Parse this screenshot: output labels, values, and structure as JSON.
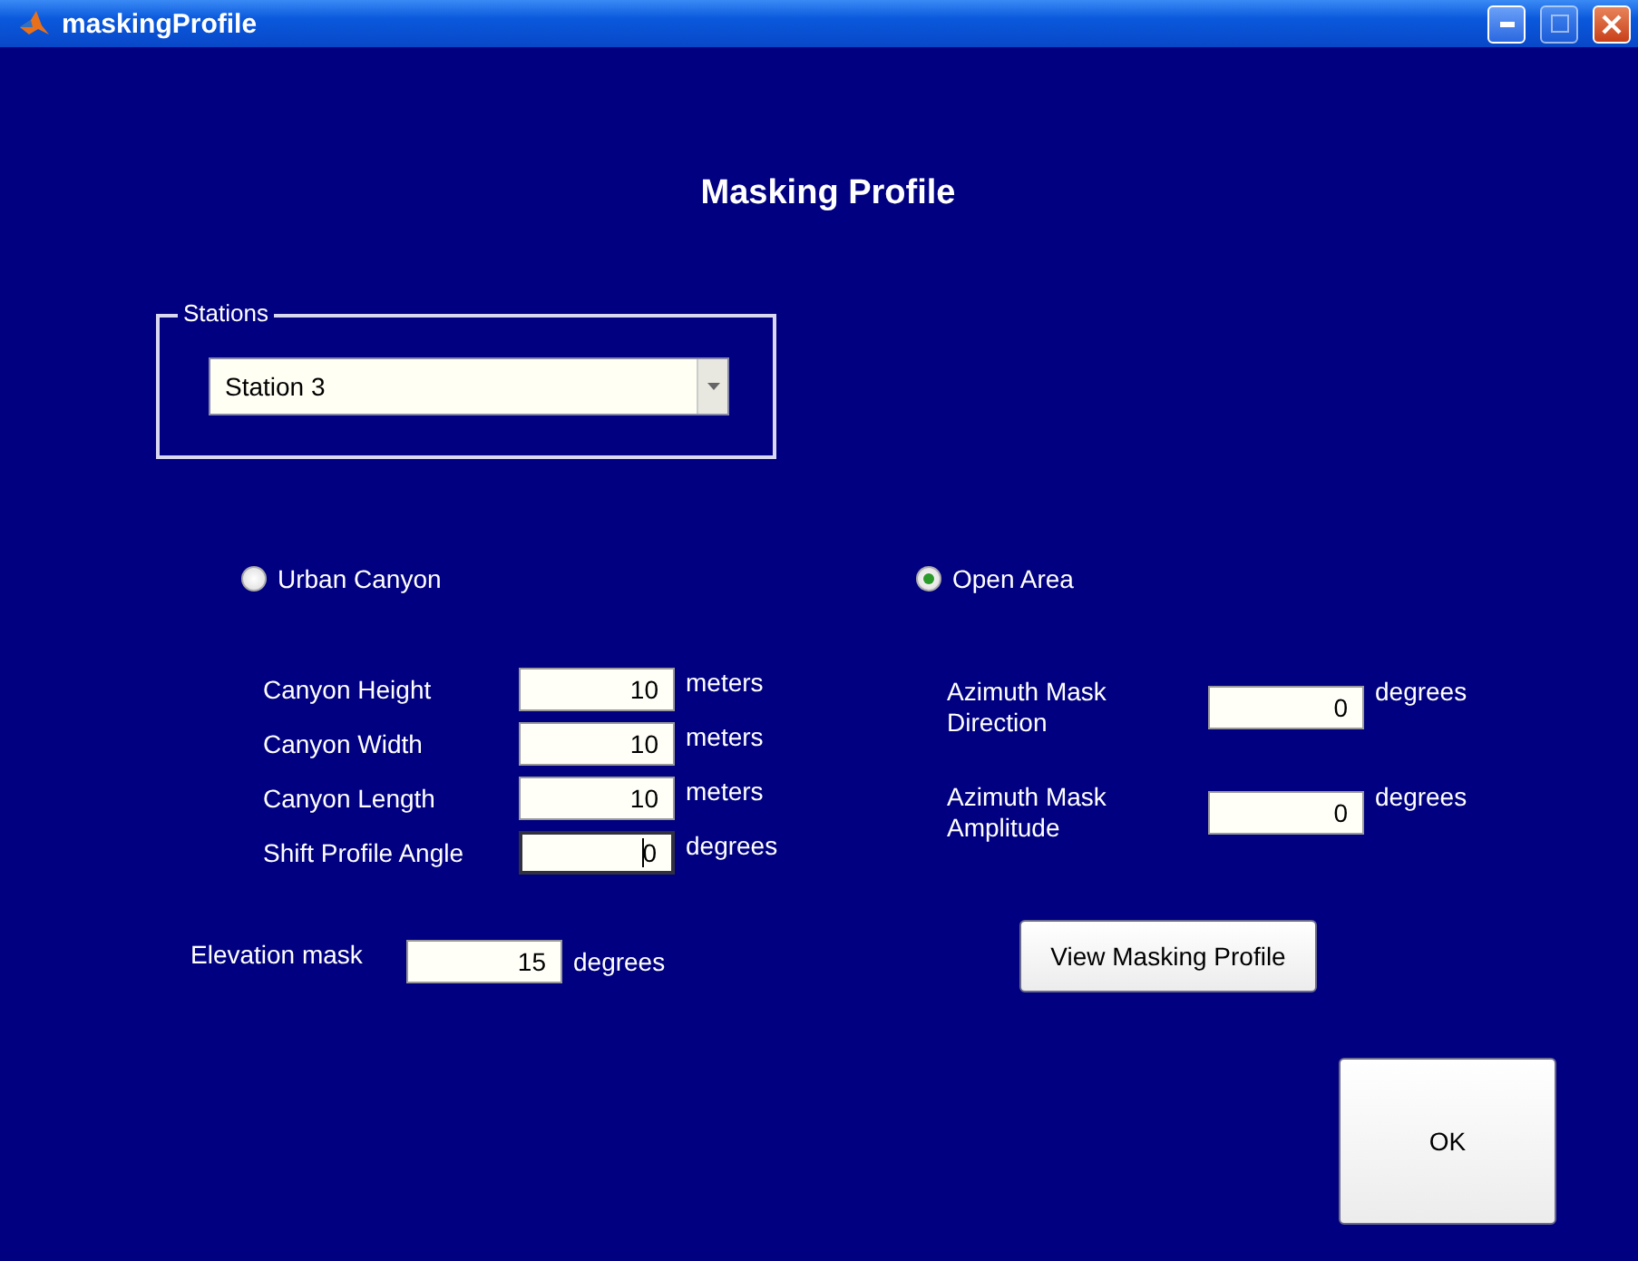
{
  "window": {
    "title": "maskingProfile"
  },
  "heading": "Masking Profile",
  "stations": {
    "label": "Stations",
    "value": "Station 3"
  },
  "modes": [
    {
      "label": "Urban Canyon",
      "selected": false
    },
    {
      "label": "Open Area",
      "selected": true
    }
  ],
  "canyon_fields": [
    {
      "label": "Canyon Height",
      "value": "10",
      "unit": "meters",
      "focused": false
    },
    {
      "label": "Canyon Width",
      "value": "10",
      "unit": "meters",
      "focused": false
    },
    {
      "label": "Canyon Length",
      "value": "10",
      "unit": "meters",
      "focused": false
    },
    {
      "label": "Shift Profile Angle",
      "value": "0",
      "unit": "degrees",
      "focused": true
    }
  ],
  "azimuth_fields": [
    {
      "label": "Azimuth Mask Direction",
      "value": "0",
      "unit": "degrees"
    },
    {
      "label": "Azimuth Mask Amplitude",
      "value": "0",
      "unit": "degrees"
    }
  ],
  "elevation": {
    "label": "Elevation mask",
    "value": "15",
    "unit": "degrees"
  },
  "buttons": {
    "view": "View Masking Profile",
    "ok": "OK"
  }
}
